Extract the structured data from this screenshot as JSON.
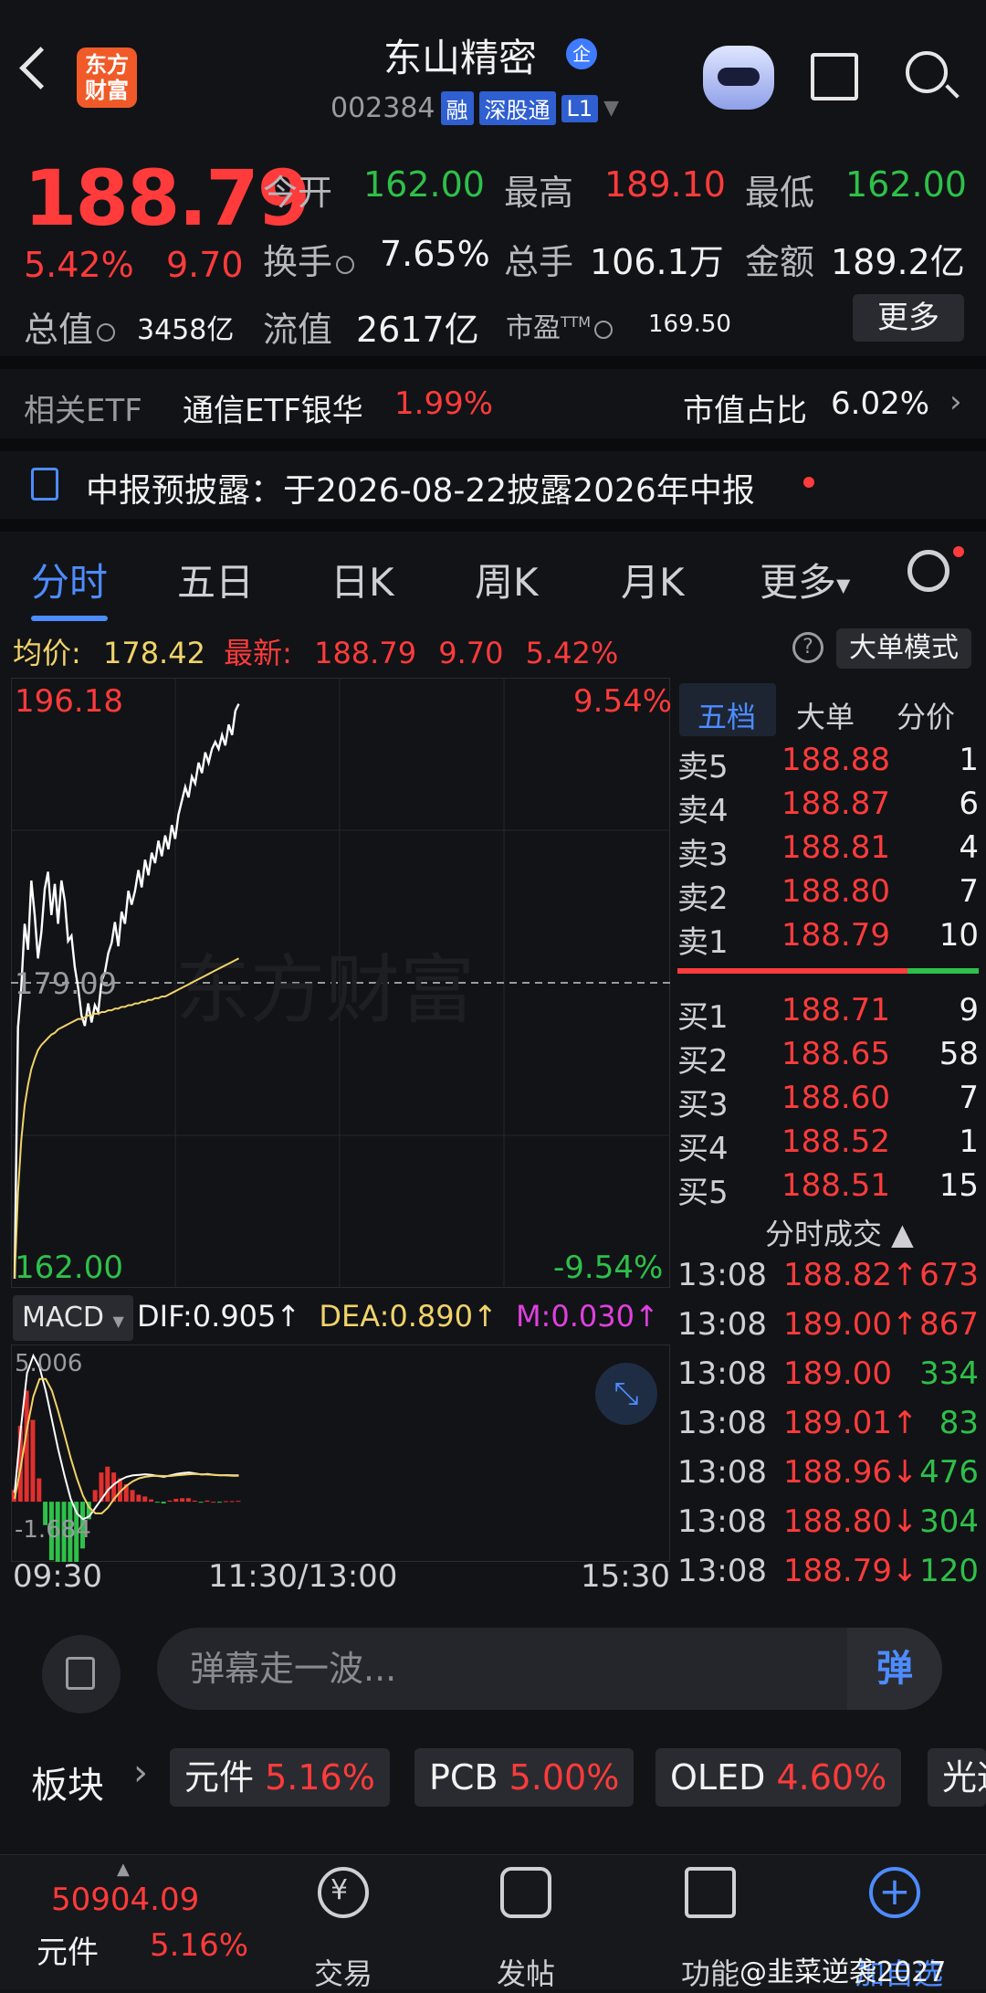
{
  "header": {
    "logo_text": "东方\n财富",
    "title": "东山精密",
    "title_badge": "企",
    "code": "002384",
    "tags": [
      "融",
      "深股通",
      "L1"
    ]
  },
  "quote": {
    "price": "188.79",
    "change_pct": "5.42%",
    "change": "9.70",
    "open_label": "今开",
    "open": "162.00",
    "high_label": "最高",
    "high": "189.10",
    "low_label": "最低",
    "low": "162.00",
    "turnover_label": "换手",
    "turnover": "7.65%",
    "volume_label": "总手",
    "volume": "106.1万",
    "amount_label": "金额",
    "amount": "189.2亿",
    "mktcap_label": "总值",
    "mktcap": "3458亿",
    "float_label": "流值",
    "float": "2617亿",
    "pe_label": "市盈",
    "pe_sup": "TTM",
    "pe": "169.50",
    "more_label": "更多"
  },
  "etf": {
    "label": "相关ETF",
    "name": "通信ETF银华",
    "pct": "1.99%",
    "ratio_label": "市值占比",
    "ratio": "6.02%"
  },
  "notice": {
    "text": "中报预披露：于2026-08-22披露2026年中报"
  },
  "tabs": [
    "分时",
    "五日",
    "日K",
    "周K",
    "月K",
    "更多"
  ],
  "summary": {
    "avg_label": "均价:",
    "avg": "178.42",
    "last_label": "最新:",
    "last": "188.79",
    "chg": "9.70",
    "pct": "5.42%",
    "help": "?",
    "mode_label": "大单模式"
  },
  "chart_data": {
    "type": "line",
    "y_top_label": "196.18",
    "y_mid_label": "179.09",
    "y_bottom_label": "162.00",
    "pct_top_label": "9.54%",
    "pct_bottom_label": "-9.54%",
    "ylim": [
      162.0,
      196.18
    ],
    "prev_close": 179.09,
    "watermark": "东方财富",
    "x_labels": [
      "09:30",
      "11:30/13:00",
      "15:30"
    ],
    "series": [
      {
        "values": [
          162.0,
          176.5,
          178.8,
          182.5,
          181.0,
          185.0,
          183.0,
          180.5,
          182.0,
          184.5,
          185.5,
          183.0,
          184.8,
          182.5,
          185.0,
          183.8,
          181.5,
          181.8,
          180.0,
          178.8,
          177.2,
          176.6,
          177.9,
          176.8,
          177.8,
          177.4,
          179.2,
          179.7,
          180.8,
          181.4,
          182.6,
          181.2,
          183.2,
          182.5,
          184.4,
          183.6,
          184.4,
          185.6,
          184.6,
          186.2,
          185.3,
          186.6,
          186.0,
          187.3,
          186.4,
          187.6,
          186.8,
          188.2,
          187.4,
          188.8,
          189.6,
          190.4,
          189.8,
          191.0,
          190.6,
          191.8,
          191.2,
          192.4,
          191.8,
          192.6,
          193.0,
          192.6,
          193.4,
          192.8,
          194.0,
          193.4,
          194.8,
          195.2
        ]
      },
      {
        "values": [
          162.0,
          167.0,
          170.0,
          172.0,
          173.2,
          174.1,
          174.7,
          175.2,
          175.5,
          175.7,
          175.9,
          176.1,
          176.2,
          176.4,
          176.5,
          176.6,
          176.7,
          176.8,
          176.9,
          177.0,
          177.0,
          177.1,
          177.2,
          177.2,
          177.3,
          177.3,
          177.4,
          177.4,
          177.5,
          177.5,
          177.6,
          177.6,
          177.7,
          177.7,
          177.8,
          177.8,
          177.9,
          177.9,
          178.0,
          178.0,
          178.1,
          178.1,
          178.2,
          178.2,
          178.3,
          178.3,
          178.4,
          178.5,
          178.6,
          178.7,
          178.8,
          178.9,
          179.0,
          179.1,
          179.2,
          179.3,
          179.4,
          179.5,
          179.6,
          179.7,
          179.8,
          179.9,
          180.0,
          180.1,
          180.2,
          180.3,
          180.4,
          180.5
        ]
      }
    ]
  },
  "macd": {
    "label": "MACD",
    "dif_label": "DIF:",
    "dif": "0.905",
    "dea_label": "DEA:",
    "dea": "0.890",
    "m_label": "M:",
    "m": "0.030",
    "arrow": "↑",
    "y_top": "5.006",
    "y_bottom": "-1.684",
    "ylim": [
      -1.684,
      5.006
    ],
    "dif_values": [
      0.3,
      2.5,
      4.4,
      5.0,
      4.6,
      3.8,
      2.8,
      1.8,
      0.9,
      0.1,
      -0.4,
      -0.6,
      -0.5,
      -0.2,
      0.1,
      0.4,
      0.6,
      0.75,
      0.85,
      0.9,
      0.92,
      0.94,
      0.92,
      0.88,
      0.85,
      0.9,
      0.95,
      0.98,
      1.0,
      0.97,
      0.93,
      0.95,
      0.92,
      0.9,
      0.91,
      0.9,
      0.905
    ],
    "dea_values": [
      0.1,
      1.2,
      2.5,
      3.6,
      4.2,
      4.2,
      3.8,
      3.1,
      2.3,
      1.5,
      0.8,
      0.2,
      -0.2,
      -0.4,
      -0.4,
      -0.2,
      0.1,
      0.35,
      0.55,
      0.7,
      0.8,
      0.85,
      0.88,
      0.89,
      0.88,
      0.88,
      0.9,
      0.92,
      0.94,
      0.95,
      0.94,
      0.93,
      0.92,
      0.91,
      0.9,
      0.89,
      0.89
    ],
    "m_values": [
      0.4,
      2.6,
      3.8,
      2.8,
      0.8,
      -0.8,
      -2.0,
      -2.6,
      -2.8,
      -2.8,
      -2.4,
      -1.6,
      -0.6,
      0.4,
      1.0,
      1.2,
      1.0,
      0.8,
      0.6,
      0.4,
      0.24,
      0.18,
      0.08,
      -0.02,
      -0.06,
      0.04,
      0.1,
      0.12,
      0.12,
      0.04,
      -0.02,
      0.04,
      0,
      -0.02,
      0.02,
      0.02,
      0.03
    ]
  },
  "orderbook": {
    "tabs": [
      "五档",
      "大单",
      "分价"
    ],
    "asks": [
      {
        "name": "卖5",
        "price": "188.88",
        "vol": "1"
      },
      {
        "name": "卖4",
        "price": "188.87",
        "vol": "6"
      },
      {
        "name": "卖3",
        "price": "188.81",
        "vol": "4"
      },
      {
        "name": "卖2",
        "price": "188.80",
        "vol": "7"
      },
      {
        "name": "卖1",
        "price": "188.79",
        "vol": "10"
      }
    ],
    "bids": [
      {
        "name": "买1",
        "price": "188.71",
        "vol": "9"
      },
      {
        "name": "买2",
        "price": "188.65",
        "vol": "58"
      },
      {
        "name": "买3",
        "price": "188.60",
        "vol": "7"
      },
      {
        "name": "买4",
        "price": "188.52",
        "vol": "1"
      },
      {
        "name": "买5",
        "price": "188.51",
        "vol": "15"
      }
    ],
    "ticks_title": "分时成交 ▲",
    "ticks": [
      {
        "time": "13:08",
        "price": "188.82↑",
        "vol": "673",
        "pc": "red",
        "vc": "red"
      },
      {
        "time": "13:08",
        "price": "189.00↑",
        "vol": "867",
        "pc": "red",
        "vc": "red"
      },
      {
        "time": "13:08",
        "price": "189.00",
        "vol": "334",
        "pc": "red",
        "vc": "green"
      },
      {
        "time": "13:08",
        "price": "189.01↑",
        "vol": "83",
        "pc": "red",
        "vc": "green"
      },
      {
        "time": "13:08",
        "price": "188.96↓",
        "vol": "476",
        "pc": "red",
        "vc": "green"
      },
      {
        "time": "13:08",
        "price": "188.80↓",
        "vol": "304",
        "pc": "red",
        "vc": "green"
      },
      {
        "time": "13:08",
        "price": "188.79↓",
        "vol": "120",
        "pc": "red",
        "vc": "green"
      }
    ]
  },
  "comment": {
    "placeholder": "弹幕走一波...",
    "send_label": "弹"
  },
  "sectors": {
    "label": "板块",
    "items": [
      {
        "name": "元件",
        "pct": "5.16%"
      },
      {
        "name": "PCB",
        "pct": "5.00%"
      },
      {
        "name": "OLED",
        "pct": "4.60%"
      },
      {
        "name": "光通"
      }
    ]
  },
  "bottom_nav": {
    "index_value": "50904.09",
    "index_name": "元件",
    "index_pct": "5.16%",
    "items": [
      "交易",
      "发帖",
      "功能",
      "加自选"
    ],
    "watermark": "@韭菜逆袭2027"
  },
  "colors": {
    "up": "#ff3b3b",
    "down": "#2ec04a",
    "accent": "#4d8cff",
    "avg_line": "#f0d36a",
    "price_line": "#ffffff"
  }
}
